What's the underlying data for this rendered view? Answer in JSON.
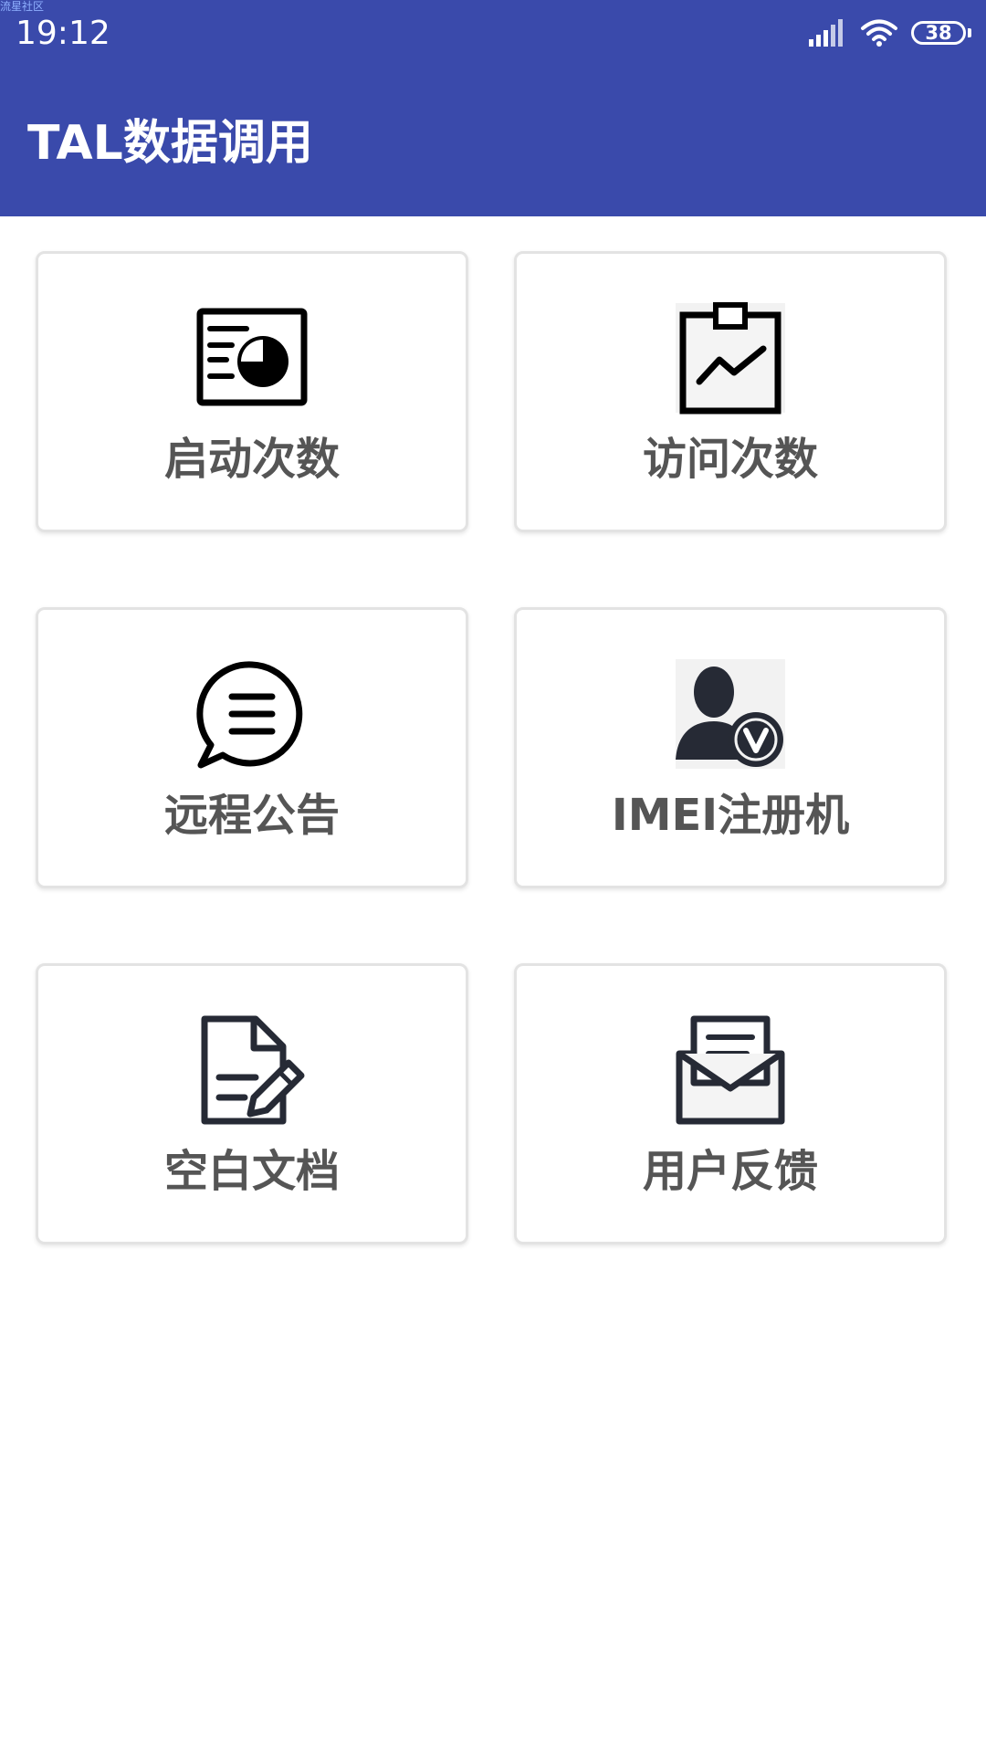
{
  "status_bar": {
    "watermark": "流星社区",
    "time": "19:12",
    "battery": "38"
  },
  "app_bar": {
    "title": "TAL数据调用"
  },
  "colors": {
    "primary": "#3a4aab",
    "card_border": "#e3e3e3",
    "label": "#555555"
  },
  "cards": [
    {
      "label": "启动次数",
      "icon": "dashboard-chart-icon"
    },
    {
      "label": "访问次数",
      "icon": "clipboard-trend-icon"
    },
    {
      "label": "远程公告",
      "icon": "chat-bubble-icon"
    },
    {
      "label": "IMEI注册机",
      "icon": "user-verified-icon"
    },
    {
      "label": "空白文档",
      "icon": "document-edit-icon"
    },
    {
      "label": "用户反馈",
      "icon": "open-envelope-icon"
    }
  ]
}
